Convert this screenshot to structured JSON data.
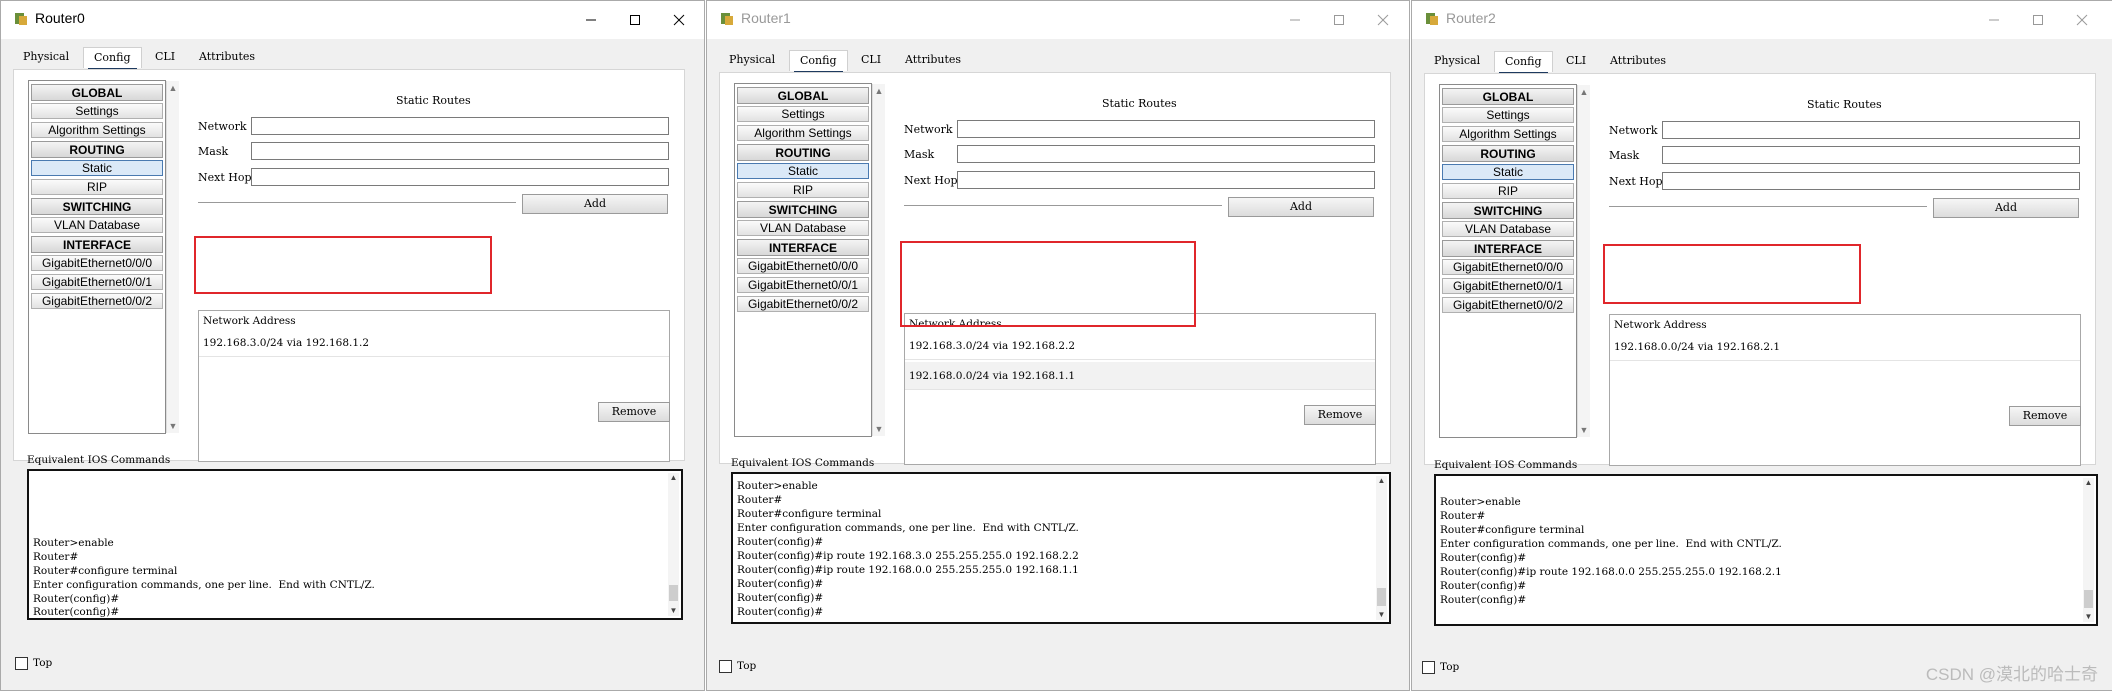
{
  "windows": [
    {
      "id": "router0",
      "title": "Router0",
      "active": true,
      "tabs": [
        "Physical",
        "Config",
        "CLI",
        "Attributes"
      ],
      "active_tab": "Config",
      "nav": {
        "global": "GLOBAL",
        "settings": "Settings",
        "algorithm": "Algorithm Settings",
        "routing": "ROUTING",
        "static": "Static",
        "rip": "RIP",
        "switching": "SWITCHING",
        "vlan": "VLAN Database",
        "interface": "INTERFACE",
        "gi0": "GigabitEthernet0/0/0",
        "gi1": "GigabitEthernet0/0/1",
        "gi2": "GigabitEthernet0/0/2"
      },
      "static_routes_title": "Static Routes",
      "network_label": "Network",
      "mask_label": "Mask",
      "nexthop_label": "Next Hop",
      "network_value": "",
      "mask_value": "",
      "nexthop_value": "",
      "add_label": "Add",
      "routes_header": "Network Address",
      "routes": [
        "192.168.3.0/24 via 192.168.1.2"
      ],
      "remove_label": "Remove",
      "equiv_label": "Equivalent IOS Commands",
      "console": [
        "Router>enable",
        "Router#",
        "Router#configure terminal",
        "Enter configuration commands, one per line.  End with CNTL/Z.",
        "Router(config)#",
        "Router(config)#"
      ],
      "top_label": "Top"
    },
    {
      "id": "router1",
      "title": "Router1",
      "active": false,
      "tabs": [
        "Physical",
        "Config",
        "CLI",
        "Attributes"
      ],
      "active_tab": "Config",
      "nav": {
        "global": "GLOBAL",
        "settings": "Settings",
        "algorithm": "Algorithm Settings",
        "routing": "ROUTING",
        "static": "Static",
        "rip": "RIP",
        "switching": "SWITCHING",
        "vlan": "VLAN Database",
        "interface": "INTERFACE",
        "gi0": "GigabitEthernet0/0/0",
        "gi1": "GigabitEthernet0/0/1",
        "gi2": "GigabitEthernet0/0/2"
      },
      "static_routes_title": "Static Routes",
      "network_label": "Network",
      "mask_label": "Mask",
      "nexthop_label": "Next Hop",
      "network_value": "",
      "mask_value": "",
      "nexthop_value": "",
      "add_label": "Add",
      "routes_header": "Network Address",
      "routes": [
        "192.168.3.0/24 via 192.168.2.2",
        "192.168.0.0/24 via 192.168.1.1"
      ],
      "remove_label": "Remove",
      "equiv_label": "Equivalent IOS Commands",
      "console": [
        "Router>enable",
        "Router#",
        "Router#configure terminal",
        "Enter configuration commands, one per line.  End with CNTL/Z.",
        "Router(config)#",
        "Router(config)#ip route 192.168.3.0 255.255.255.0 192.168.2.2",
        "Router(config)#ip route 192.168.0.0 255.255.255.0 192.168.1.1",
        "Router(config)#",
        "Router(config)#",
        "Router(config)#"
      ],
      "top_label": "Top"
    },
    {
      "id": "router2",
      "title": "Router2",
      "active": false,
      "tabs": [
        "Physical",
        "Config",
        "CLI",
        "Attributes"
      ],
      "active_tab": "Config",
      "nav": {
        "global": "GLOBAL",
        "settings": "Settings",
        "algorithm": "Algorithm Settings",
        "routing": "ROUTING",
        "static": "Static",
        "rip": "RIP",
        "switching": "SWITCHING",
        "vlan": "VLAN Database",
        "interface": "INTERFACE",
        "gi0": "GigabitEthernet0/0/0",
        "gi1": "GigabitEthernet0/0/1",
        "gi2": "GigabitEthernet0/0/2"
      },
      "static_routes_title": "Static Routes",
      "network_label": "Network",
      "mask_label": "Mask",
      "nexthop_label": "Next Hop",
      "network_value": "",
      "mask_value": "",
      "nexthop_value": "",
      "add_label": "Add",
      "routes_header": "Network Address",
      "routes": [
        "192.168.0.0/24 via 192.168.2.1"
      ],
      "remove_label": "Remove",
      "equiv_label": "Equivalent IOS Commands",
      "console": [
        "Router>enable",
        "Router#",
        "Router#configure terminal",
        "Enter configuration commands, one per line.  End with CNTL/Z.",
        "Router(config)#",
        "Router(config)#ip route 192.168.0.0 255.255.255.0 192.168.2.1",
        "Router(config)#",
        "Router(config)#"
      ],
      "top_label": "Top"
    }
  ],
  "watermark": "CSDN @漠北的哈士奇",
  "colors": {
    "highlight": "#e0262b",
    "tab_underline": "#1e3a5f",
    "selected_nav": "#dbe9f7"
  }
}
